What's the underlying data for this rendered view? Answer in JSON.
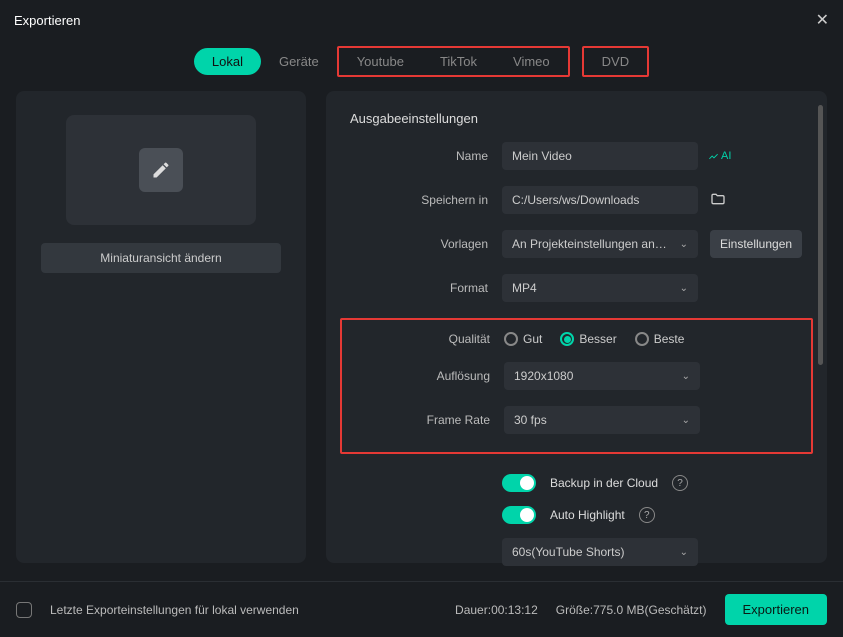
{
  "window": {
    "title": "Exportieren"
  },
  "tabs": {
    "lokal": "Lokal",
    "geraete": "Geräte",
    "youtube": "Youtube",
    "tiktok": "TikTok",
    "vimeo": "Vimeo",
    "dvd": "DVD"
  },
  "left": {
    "thumb_button": "Miniaturansicht ändern"
  },
  "settings": {
    "section_title": "Ausgabeeinstellungen",
    "name_label": "Name",
    "name_value": "Mein Video",
    "ai_badge": "AI",
    "save_label": "Speichern in",
    "save_value": "C:/Users/ws/Downloads",
    "templates_label": "Vorlagen",
    "templates_value": "An Projekteinstellungen anpassen",
    "settings_button": "Einstellungen",
    "format_label": "Format",
    "format_value": "MP4",
    "quality_label": "Qualität",
    "quality_options": {
      "good": "Gut",
      "better": "Besser",
      "best": "Beste"
    },
    "resolution_label": "Auflösung",
    "resolution_value": "1920x1080",
    "framerate_label": "Frame Rate",
    "framerate_value": "30 fps",
    "backup_label": "Backup in der Cloud",
    "highlight_label": "Auto Highlight",
    "shorts_value": "60s(YouTube Shorts)"
  },
  "footer": {
    "reuse_label": "Letzte Exporteinstellungen für lokal verwenden",
    "duration_label": "Dauer:",
    "duration_value": "00:13:12",
    "size_label": "Größe:",
    "size_value": "775.0 MB(Geschätzt)",
    "export_button": "Exportieren"
  }
}
